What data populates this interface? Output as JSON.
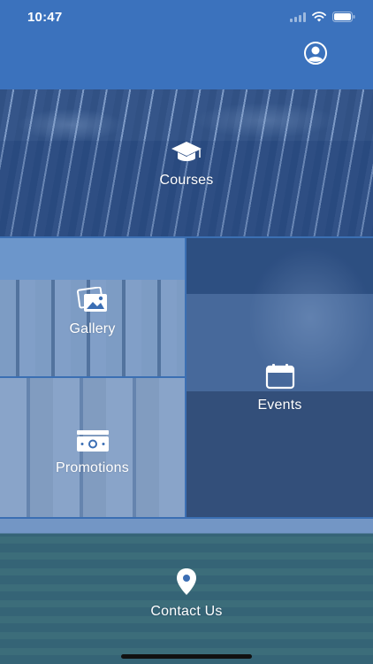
{
  "status_bar": {
    "time": "10:47"
  },
  "header": {
    "profile_icon": "user-circle-icon"
  },
  "tiles": {
    "courses": {
      "label": "Courses",
      "icon": "graduation-cap-icon"
    },
    "gallery": {
      "label": "Gallery",
      "icon": "photos-icon"
    },
    "events": {
      "label": "Events",
      "icon": "calendar-icon"
    },
    "promotions": {
      "label": "Promotions",
      "icon": "banknote-icon"
    },
    "contact": {
      "label": "Contact Us",
      "icon": "map-pin-icon"
    }
  },
  "colors": {
    "header_bg": "#3b72bd",
    "overlay": "#3b6eb4"
  }
}
